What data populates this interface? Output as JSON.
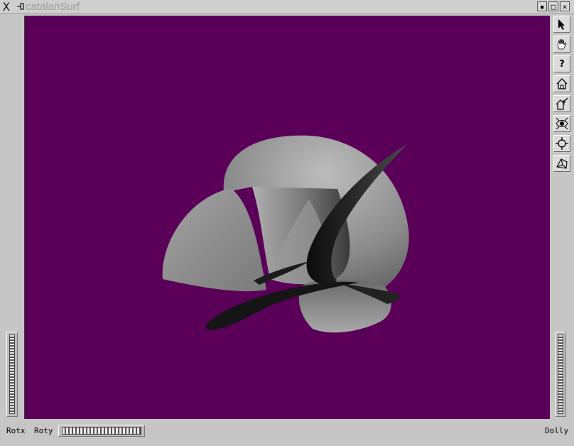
{
  "window": {
    "title": "catalanSurf",
    "buttons": {
      "minimize": "▪",
      "maximize": "□",
      "close": "✕"
    }
  },
  "viewer": {
    "background_color": "#5a0058",
    "surface_color": "#8c8c8c"
  },
  "toolbar": {
    "items": [
      "pick-arrow-icon",
      "hand-view-icon",
      "help-icon",
      "home-icon",
      "set-home-icon",
      "view-all-icon",
      "seek-icon",
      "projection-icon"
    ],
    "help_label": "?"
  },
  "wheels": {
    "rotx_label": "Rotx",
    "roty_label": "Roty",
    "dolly_label": "Dolly"
  }
}
